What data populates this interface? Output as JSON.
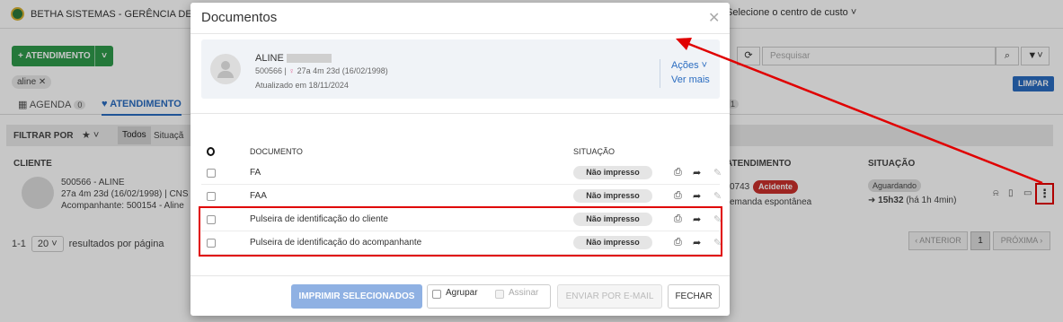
{
  "app": {
    "title": "BETHA SISTEMAS - GERÊNCIA DE PR...",
    "cost_center": "Selecione o centro de custo",
    "new_button": "+ ATENDIMENTO",
    "filter_chip": "aline",
    "tabs": [
      {
        "label": "AGENDA",
        "count": "0"
      },
      {
        "label": "ATENDIMENTO",
        "count": ""
      },
      {
        "label": "",
        "count": "1"
      }
    ],
    "filter": {
      "label": "FILTRAR POR",
      "all": "Todos",
      "situation": "Situaçã"
    },
    "search_placeholder": "Pesquisar",
    "clear_button": "LIMPAR",
    "columns": {
      "client": "CLIENTE",
      "attendance": "ATENDIMENTO",
      "situation": "SITUAÇÃO"
    },
    "row": {
      "line1": "500566 - ALINE",
      "line2": "27a 4m 23d (16/02/1998) | CNS",
      "line3": "Acompanhante: 500154 - Aline",
      "code": "0743",
      "tag": "Acidente",
      "demand": "emanda espontânea",
      "status": "Aguardando",
      "time": "15h32",
      "elapsed": "(há 1h 4min)"
    },
    "pager": {
      "range": "1-1",
      "size": "20",
      "label": "resultados por página",
      "prev": "‹ ANTERIOR",
      "current": "1",
      "next": "PRÓXIMA ›"
    }
  },
  "modal": {
    "title": "Documentos",
    "patient": {
      "name": "ALINE",
      "id": "500566",
      "age": "27a 4m 23d (16/02/1998)",
      "updated": "Atualizado em 18/11/2024"
    },
    "actions": "Ações",
    "see_more": "Ver mais",
    "table_headers": {
      "document": "DOCUMENTO",
      "situation": "SITUAÇÃO"
    },
    "documents": [
      {
        "name": "FA",
        "status": "Não impresso"
      },
      {
        "name": "FAA",
        "status": "Não impresso"
      },
      {
        "name": "Pulseira de identificação do cliente",
        "status": "Não impresso"
      },
      {
        "name": "Pulseira de identificação do acompanhante",
        "status": "Não impresso"
      }
    ],
    "footer": {
      "print_selected": "IMPRIMIR SELECIONADOS",
      "group": "Agrupar",
      "sign": "Assinar",
      "send_email": "ENVIAR POR E-MAIL",
      "close": "FECHAR"
    }
  },
  "annotation_color": "#e00000"
}
